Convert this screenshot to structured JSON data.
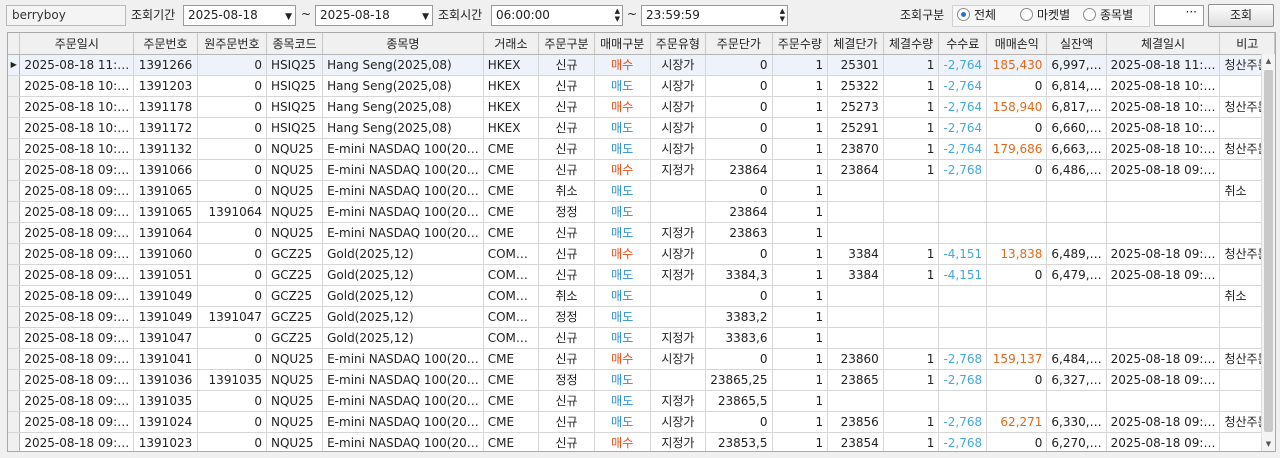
{
  "toolbar": {
    "user": "berryboy",
    "period_label": "조회기간",
    "date_from": "2025-08-18",
    "date_to": "2025-08-18",
    "time_label": "조회시간",
    "time_from": "06:00:00",
    "time_to": "23:59:59",
    "tilde": "~",
    "category_label": "조회구분",
    "radio_all": "전체",
    "radio_market": "마켓별",
    "radio_item": "종목별",
    "extra_field": "···",
    "search_button": "조회"
  },
  "grid": {
    "headers": [
      "주문일시",
      "주문번호",
      "원주문번호",
      "종목코드",
      "종목명",
      "거래소",
      "주문구분",
      "매매구분",
      "주문유형",
      "주문단가",
      "주문수량",
      "체결단가",
      "체결수량",
      "수수료",
      "매매손익",
      "실잔액",
      "체결일시",
      "비고"
    ],
    "rows": [
      [
        "2025-08-18 11:…",
        "1391266",
        "0",
        "HSIQ25",
        "Hang Seng(2025,08)",
        "HKEX",
        "신규",
        "매수",
        "시장가",
        "0",
        "1",
        "25301",
        "1",
        "-2,764",
        "185,430",
        "6,997,…",
        "2025-08-18 11:…",
        "청산주문"
      ],
      [
        "2025-08-18 10:…",
        "1391203",
        "0",
        "HSIQ25",
        "Hang Seng(2025,08)",
        "HKEX",
        "신규",
        "매도",
        "시장가",
        "0",
        "1",
        "25322",
        "1",
        "-2,764",
        "0",
        "6,814,…",
        "2025-08-18 10:…",
        ""
      ],
      [
        "2025-08-18 10:…",
        "1391178",
        "0",
        "HSIQ25",
        "Hang Seng(2025,08)",
        "HKEX",
        "신규",
        "매수",
        "시장가",
        "0",
        "1",
        "25273",
        "1",
        "-2,764",
        "158,940",
        "6,817,…",
        "2025-08-18 10:…",
        "청산주문"
      ],
      [
        "2025-08-18 10:…",
        "1391172",
        "0",
        "HSIQ25",
        "Hang Seng(2025,08)",
        "HKEX",
        "신규",
        "매도",
        "시장가",
        "0",
        "1",
        "25291",
        "1",
        "-2,764",
        "0",
        "6,660,…",
        "2025-08-18 10:…",
        ""
      ],
      [
        "2025-08-18 10:…",
        "1391132",
        "0",
        "NQU25",
        "E-mini NASDAQ 100(20…",
        "CME",
        "신규",
        "매도",
        "시장가",
        "0",
        "1",
        "23870",
        "1",
        "-2,764",
        "179,686",
        "6,663,…",
        "2025-08-18 10:…",
        "청산주문"
      ],
      [
        "2025-08-18 09:…",
        "1391066",
        "0",
        "NQU25",
        "E-mini NASDAQ 100(20…",
        "CME",
        "신규",
        "매수",
        "지정가",
        "23864",
        "1",
        "23864",
        "1",
        "-2,768",
        "0",
        "6,486,…",
        "2025-08-18 09:…",
        ""
      ],
      [
        "2025-08-18 09:…",
        "1391065",
        "0",
        "NQU25",
        "E-mini NASDAQ 100(20…",
        "CME",
        "취소",
        "매도",
        "",
        "0",
        "1",
        "",
        "",
        "",
        "",
        "",
        "",
        "취소"
      ],
      [
        "2025-08-18 09:…",
        "1391065",
        "1391064",
        "NQU25",
        "E-mini NASDAQ 100(20…",
        "CME",
        "정정",
        "매도",
        "",
        "23864",
        "1",
        "",
        "",
        "",
        "",
        "",
        "",
        ""
      ],
      [
        "2025-08-18 09:…",
        "1391064",
        "0",
        "NQU25",
        "E-mini NASDAQ 100(20…",
        "CME",
        "신규",
        "매도",
        "지정가",
        "23863",
        "1",
        "",
        "",
        "",
        "",
        "",
        "",
        ""
      ],
      [
        "2025-08-18 09:…",
        "1391060",
        "0",
        "GCZ25",
        "Gold(2025,12)",
        "COM…",
        "신규",
        "매수",
        "시장가",
        "0",
        "1",
        "3384",
        "1",
        "-4,151",
        "13,838",
        "6,489,…",
        "2025-08-18 09:…",
        "청산주문"
      ],
      [
        "2025-08-18 09:…",
        "1391051",
        "0",
        "GCZ25",
        "Gold(2025,12)",
        "COM…",
        "신규",
        "매도",
        "지정가",
        "3384,3",
        "1",
        "3384",
        "1",
        "-4,151",
        "0",
        "6,479,…",
        "2025-08-18 09:…",
        ""
      ],
      [
        "2025-08-18 09:…",
        "1391049",
        "0",
        "GCZ25",
        "Gold(2025,12)",
        "COM…",
        "취소",
        "매도",
        "",
        "0",
        "1",
        "",
        "",
        "",
        "",
        "",
        "",
        "취소"
      ],
      [
        "2025-08-18 09:…",
        "1391049",
        "1391047",
        "GCZ25",
        "Gold(2025,12)",
        "COM…",
        "정정",
        "매도",
        "",
        "3383,2",
        "1",
        "",
        "",
        "",
        "",
        "",
        "",
        ""
      ],
      [
        "2025-08-18 09:…",
        "1391047",
        "0",
        "GCZ25",
        "Gold(2025,12)",
        "COM…",
        "신규",
        "매도",
        "지정가",
        "3383,6",
        "1",
        "",
        "",
        "",
        "",
        "",
        "",
        ""
      ],
      [
        "2025-08-18 09:…",
        "1391041",
        "0",
        "NQU25",
        "E-mini NASDAQ 100(20…",
        "CME",
        "신규",
        "매수",
        "시장가",
        "0",
        "1",
        "23860",
        "1",
        "-2,768",
        "159,137",
        "6,484,…",
        "2025-08-18 09:…",
        "청산주문"
      ],
      [
        "2025-08-18 09:…",
        "1391036",
        "1391035",
        "NQU25",
        "E-mini NASDAQ 100(20…",
        "CME",
        "정정",
        "매도",
        "",
        "23865,25",
        "1",
        "23865",
        "1",
        "-2,768",
        "0",
        "6,327,…",
        "2025-08-18 09:…",
        ""
      ],
      [
        "2025-08-18 09:…",
        "1391035",
        "0",
        "NQU25",
        "E-mini NASDAQ 100(20…",
        "CME",
        "신규",
        "매도",
        "지정가",
        "23865,5",
        "1",
        "",
        "",
        "",
        "",
        "",
        "",
        ""
      ],
      [
        "2025-08-18 09:…",
        "1391024",
        "0",
        "NQU25",
        "E-mini NASDAQ 100(20…",
        "CME",
        "신규",
        "매도",
        "시장가",
        "0",
        "1",
        "23856",
        "1",
        "-2,768",
        "62,271",
        "6,330,…",
        "2025-08-18 09:…",
        "청산주문"
      ],
      [
        "2025-08-18 09:…",
        "1391023",
        "0",
        "NQU25",
        "E-mini NASDAQ 100(20…",
        "CME",
        "신규",
        "매수",
        "지정가",
        "23853,5",
        "1",
        "23854",
        "1",
        "-2,768",
        "0",
        "6,270,…",
        "2025-08-18 09:…",
        ""
      ]
    ],
    "selected_row_marker": "▶"
  },
  "colors": {
    "buy": "#e0501a",
    "sell": "#2e8fd0",
    "fee": "#46a8d8",
    "profit": "#e06a1a"
  }
}
